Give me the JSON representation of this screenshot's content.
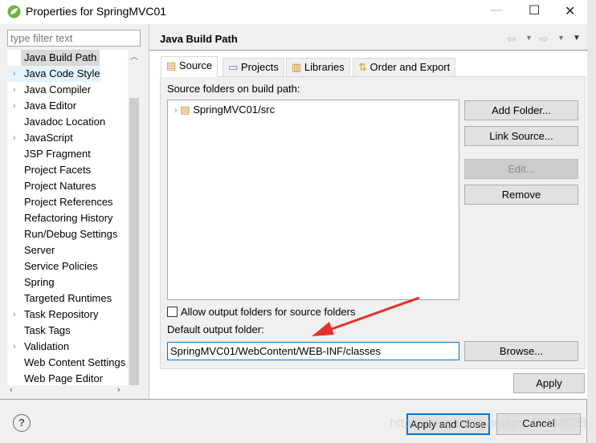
{
  "window": {
    "title": "Properties for SpringMVC01",
    "minimize": "—",
    "maximize": "☐",
    "close": "✕"
  },
  "sidebar": {
    "filter_placeholder": "type filter text",
    "items": [
      {
        "label": "Java Build Path",
        "expandable": false,
        "selected": true
      },
      {
        "label": "Java Code Style",
        "expandable": true,
        "hover": true
      },
      {
        "label": "Java Compiler",
        "expandable": true
      },
      {
        "label": "Java Editor",
        "expandable": true
      },
      {
        "label": "Javadoc Location",
        "expandable": false
      },
      {
        "label": "JavaScript",
        "expandable": true
      },
      {
        "label": "JSP Fragment",
        "expandable": false
      },
      {
        "label": "Project Facets",
        "expandable": false
      },
      {
        "label": "Project Natures",
        "expandable": false
      },
      {
        "label": "Project References",
        "expandable": false
      },
      {
        "label": "Refactoring History",
        "expandable": false
      },
      {
        "label": "Run/Debug Settings",
        "expandable": false
      },
      {
        "label": "Server",
        "expandable": false
      },
      {
        "label": "Service Policies",
        "expandable": false
      },
      {
        "label": "Spring",
        "expandable": false
      },
      {
        "label": "Targeted Runtimes",
        "expandable": false
      },
      {
        "label": "Task Repository",
        "expandable": true
      },
      {
        "label": "Task Tags",
        "expandable": false
      },
      {
        "label": "Validation",
        "expandable": true
      },
      {
        "label": "Web Content Settings",
        "expandable": false
      },
      {
        "label": "Web Page Editor",
        "expandable": false
      }
    ]
  },
  "page": {
    "title": "Java Build Path",
    "tabs": [
      {
        "label": "Source",
        "active": true
      },
      {
        "label": "Projects"
      },
      {
        "label": "Libraries"
      },
      {
        "label": "Order and Export"
      }
    ],
    "source_label": "Source folders on build path:",
    "source_folders": [
      "SpringMVC01/src"
    ],
    "buttons": {
      "add_folder": "Add Folder...",
      "link_source": "Link Source...",
      "edit": "Edit...",
      "remove": "Remove",
      "browse": "Browse...",
      "apply": "Apply"
    },
    "allow_output_label": "Allow output folders for source folders",
    "allow_output_checked": false,
    "default_output_label": "Default output folder:",
    "default_output_value": "SpringMVC01/WebContent/WEB-INF/classes"
  },
  "footer": {
    "help": "?",
    "apply_close": "Apply and Close",
    "cancel": "Cancel"
  },
  "watermark": "https://blog.csdn.net/qq_42288638",
  "colors": {
    "accent": "#0078d7",
    "arrow": "#e8302a"
  }
}
